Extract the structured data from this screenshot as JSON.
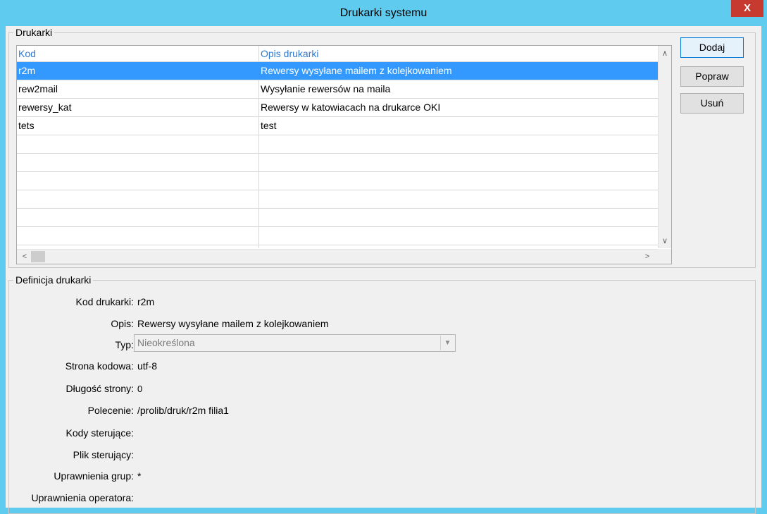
{
  "window": {
    "title": "Drukarki systemu",
    "close_label": "X"
  },
  "printers_group": {
    "legend": "Drukarki",
    "columns": [
      "Kod",
      "Opis drukarki"
    ],
    "rows": [
      {
        "code": "r2m",
        "desc": "Rewersy wysyłane mailem z kolejkowaniem",
        "selected": true
      },
      {
        "code": "rew2mail",
        "desc": "Wysyłanie rewersów na maila",
        "selected": false
      },
      {
        "code": "rewersy_kat",
        "desc": "Rewersy w katowiacach na drukarce OKI",
        "selected": false
      },
      {
        "code": "tets",
        "desc": "test",
        "selected": false
      }
    ],
    "empty_rows": 6
  },
  "actions": {
    "add_label": "Dodaj",
    "edit_label": "Popraw",
    "delete_label": "Usuń"
  },
  "definition": {
    "legend": "Definicja drukarki",
    "fields": {
      "code": {
        "label": "Kod drukarki:",
        "value": "r2m"
      },
      "desc": {
        "label": "Opis:",
        "value": "Rewersy wysyłane mailem z kolejkowaniem"
      },
      "type": {
        "label": "Typ:",
        "value": "Nieokreślona"
      },
      "codepage": {
        "label": "Strona kodowa:",
        "value": "utf-8"
      },
      "page_length": {
        "label": "Długość strony:",
        "value": "0"
      },
      "command": {
        "label": "Polecenie:",
        "value": "/prolib/druk/r2m filia1"
      },
      "control_codes": {
        "label": "Kody sterujące:",
        "value": ""
      },
      "control_file": {
        "label": "Plik sterujący:",
        "value": ""
      },
      "group_perms": {
        "label": "Uprawnienia grup:",
        "value": "*"
      },
      "operator_perms": {
        "label": "Uprawnienia operatora:",
        "value": ""
      }
    }
  },
  "icons": {
    "scroll_up": "chevron-up-icon",
    "scroll_down": "chevron-down-icon",
    "scroll_left": "chevron-left-icon",
    "scroll_right": "chevron-right-icon",
    "combo_drop": "chevron-down-icon"
  },
  "colors": {
    "titlebar": "#5ecbef",
    "close": "#c73a2f",
    "selection": "#3399ff",
    "header_text": "#2f7bd0"
  }
}
